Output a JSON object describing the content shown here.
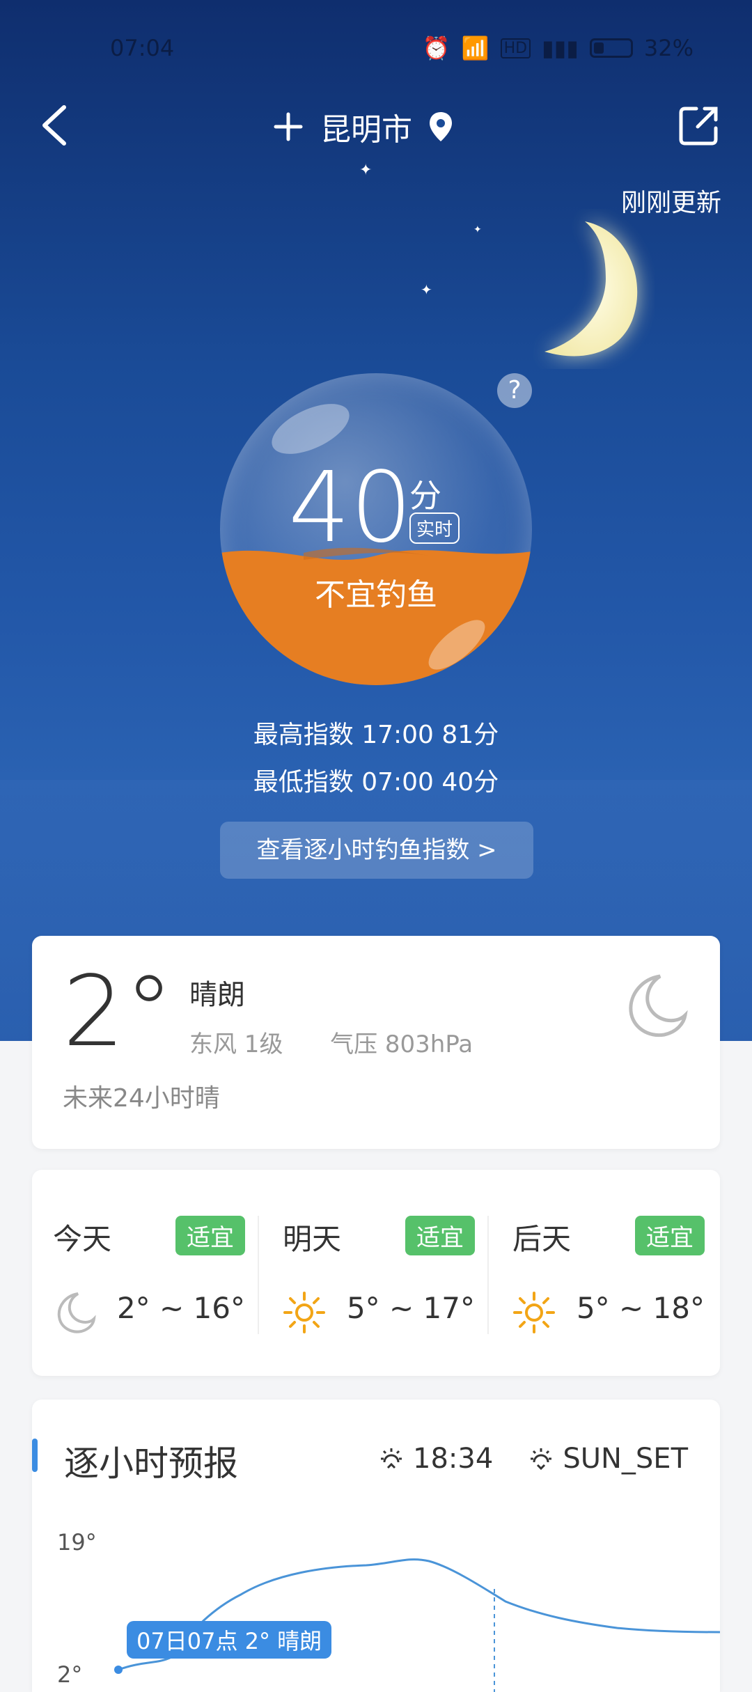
{
  "status": {
    "time": "07:04",
    "battery": "32%"
  },
  "header": {
    "city": "昆明市",
    "updated": "刚刚更新"
  },
  "fishing": {
    "score": "40",
    "unit": "分",
    "live_label": "实时",
    "verdict": "不宜钓鱼",
    "max_line": "最高指数  17:00  81分",
    "min_line": "最低指数  07:00  40分",
    "hourly_button": "查看逐小时钓鱼指数  >",
    "help": "?"
  },
  "current": {
    "temp": "2°",
    "condition": "晴朗",
    "wind": "东风  1级",
    "pressure": "气压  803hPa",
    "forecast24": "未来24小时晴"
  },
  "days": [
    {
      "name": "今天",
      "badge": "适宜",
      "range": "2° ~ 16°",
      "icon": "moon-icon"
    },
    {
      "name": "明天",
      "badge": "适宜",
      "range": "5° ~ 17°",
      "icon": "sun-icon"
    },
    {
      "name": "后天",
      "badge": "适宜",
      "range": "5° ~ 18°",
      "icon": "sun-icon"
    }
  ],
  "hourly": {
    "title": "逐小时预报",
    "sunrise": "18:34",
    "sunset": "SUN_SET",
    "y_top": "19°",
    "y_bottom": "2°",
    "tooltip": "07日07点 2° 晴朗"
  },
  "colors": {
    "accent": "#3b8ce2",
    "badge": "#56c16a",
    "orb_fill": "#e67e22"
  }
}
